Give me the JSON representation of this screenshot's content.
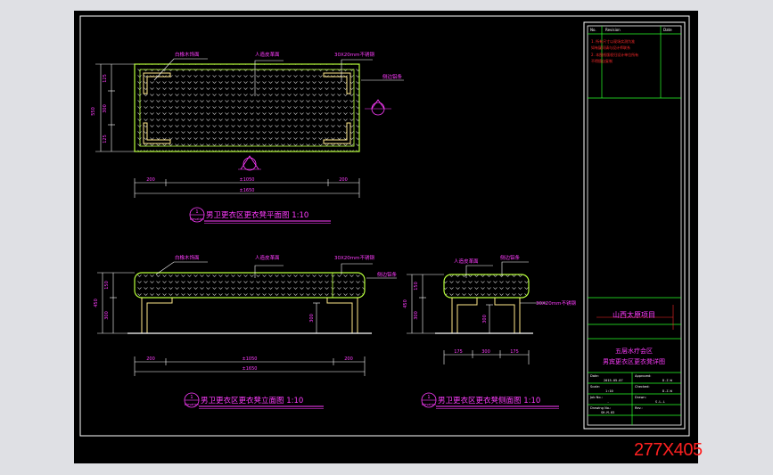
{
  "plan": {
    "title": "男卫更衣区更衣凳平面图 1:10",
    "mark_number": "1",
    "mark_sheet": "Elevation",
    "label_left": "白橡木饰面",
    "label_mid": "人造皮革面",
    "label_right": "30X20mm不锈钢",
    "label_edge": "侧边铝条",
    "dim_left": "200",
    "dim_mid": "±1050",
    "dim_right": "200",
    "dim_total": "±1650",
    "dim_depth_total": "550",
    "dim_depth_a": "125",
    "dim_depth_b": "300",
    "dim_depth_c": "125"
  },
  "elevation": {
    "title": "男卫更衣区更衣凳立面图 1:10",
    "mark_number": "1",
    "mark_sheet": "Elevation",
    "label_left": "白橡木饰面",
    "label_mid": "人造皮革面",
    "label_right": "30X20mm不锈钢",
    "label_edge": "侧边铝条",
    "dim_left": "200",
    "dim_mid": "±1050",
    "dim_right": "200",
    "dim_total": "±1650",
    "dim_h_total": "450",
    "dim_h_top": "150",
    "dim_h_leg": "300",
    "dim_leg": "300"
  },
  "side": {
    "title": "男卫更衣区更衣凳侧面图 1:10",
    "mark_number": "1",
    "mark_sheet": "Elevation",
    "label_mid": "人造皮革面",
    "label_edge": "侧边铝条",
    "label_right": "30X20mm不锈钢",
    "dim_a": "175",
    "dim_b": "300",
    "dim_c": "175",
    "dim_h_total": "450",
    "dim_h_top": "150",
    "dim_h_leg": "300",
    "dim_leg": "300"
  },
  "title_block": {
    "header_left": "No.",
    "header_mid": "Revision",
    "header_right": "Date",
    "note_1": "1. 所有尺寸以现场实测为准",
    "note_2": "   如有疑问请与设计师联系",
    "note_3": "2. 本图纸版权归设计单位所有",
    "note_4": "   不得擅自复制",
    "project": "山西太原项目",
    "area": "五层水疗会区",
    "drawing": "男宾更衣区更衣凳详图",
    "date_label": "Date:",
    "date_value": "2015-05-07",
    "approved_label": "Approved:",
    "approved_value": "D.Z.W",
    "scale_label": "Scale:",
    "scale_value": "1:10",
    "checked_label": "Checked:",
    "checked_value": "D.Z.W",
    "job_label": "Job No.:",
    "job_value": "-",
    "drawn_label": "Drawn:",
    "drawn_value": "S.L.L",
    "dwg_label": "Drawing No.:",
    "dwg_value": "SH-M-03",
    "rev_label": "Rev.:",
    "rev_value": ""
  },
  "size_label": "277X405",
  "colors": {
    "background": "#000000",
    "frame": "#ffffff",
    "dim_lines": "#ffffff",
    "bench_outline": "#b8ff3c",
    "steel_frame": "#ffe98a",
    "text": "#ff3cff",
    "accent_red": "#ff2a2a",
    "titleblock_lines": "#29ff29"
  }
}
